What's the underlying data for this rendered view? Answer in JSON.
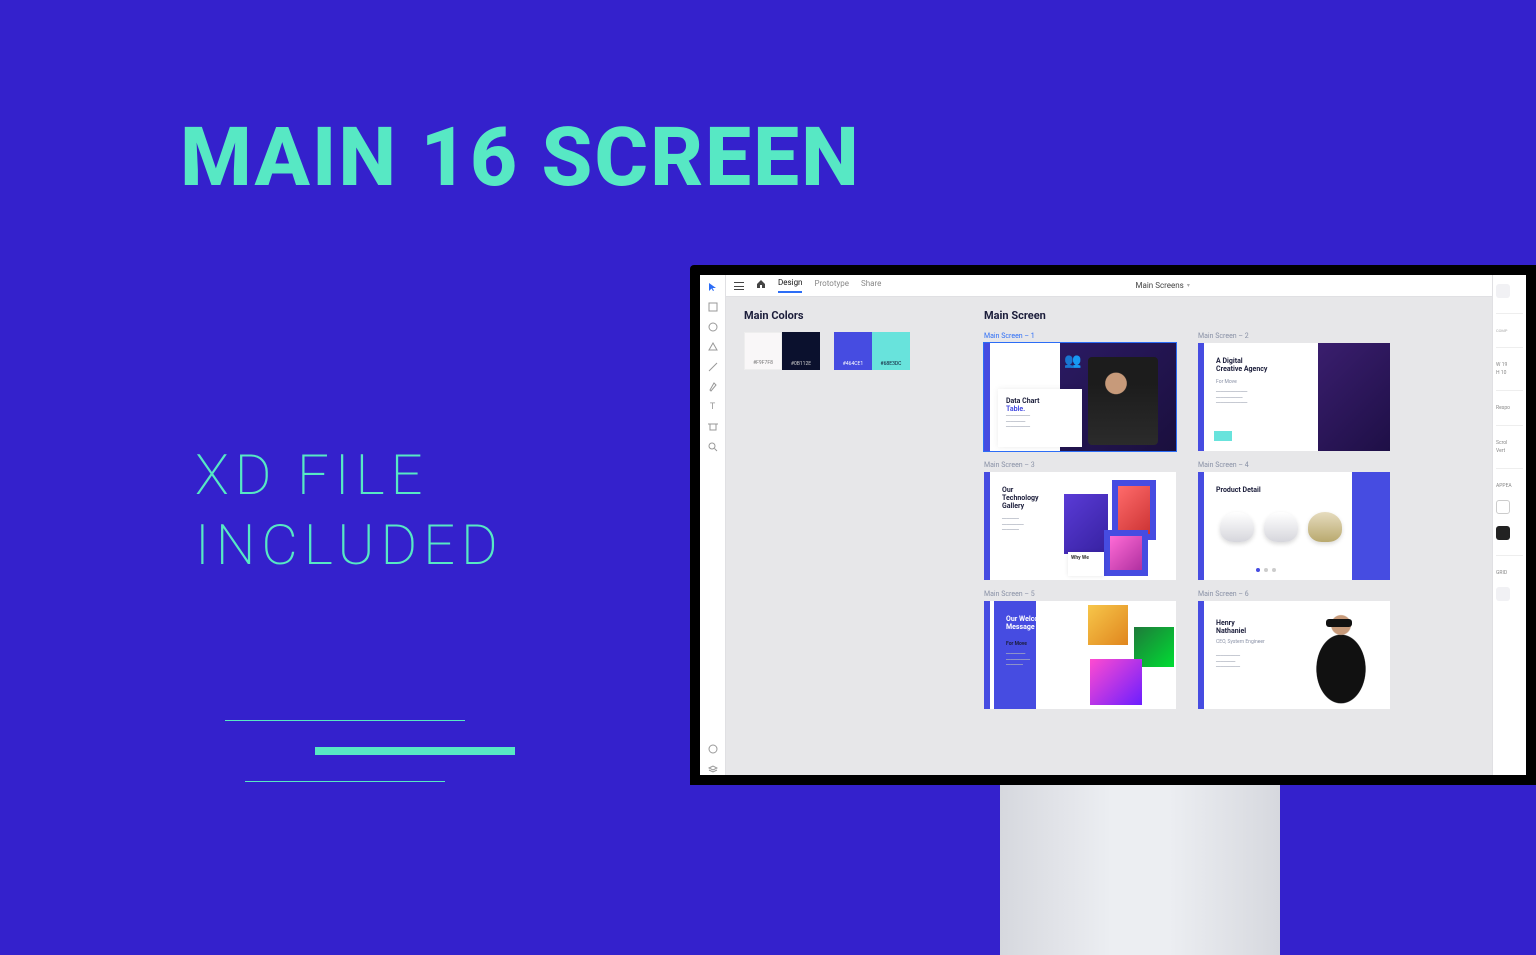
{
  "promo": {
    "headline": "MAIN 16 SCREEN",
    "subhead": "XD FILE\nINCLUDED"
  },
  "app": {
    "tabs": {
      "design": "Design",
      "prototype": "Prototype",
      "share": "Share"
    },
    "doc_title": "Main Screens",
    "sections": {
      "colors_title": "Main Colors",
      "screens_title": "Main Screen"
    },
    "swatches": [
      {
        "hex": "#F9F7F8"
      },
      {
        "hex": "#0B112E"
      },
      {
        "hex": "#464CE1"
      },
      {
        "hex": "#68E3DC"
      }
    ],
    "artboards": [
      {
        "label": "Main Screen – 1",
        "title1": "Data Chart",
        "title2": "Table."
      },
      {
        "label": "Main Screen – 2",
        "title": "A Digital\nCreative Agency",
        "sub": "For Move"
      },
      {
        "label": "Main Screen – 3",
        "title": "Our\nTechnology\nGallery",
        "why": "Why We"
      },
      {
        "label": "Main Screen – 4",
        "title": "Product Detail"
      },
      {
        "label": "Main Screen – 5",
        "title": "Our Welcome\nMessage",
        "sub": "For Move"
      },
      {
        "label": "Main Screen – 6",
        "title": "Henry\nNathaniel",
        "sub": "CEO, System Engineer"
      }
    ],
    "right_panel": {
      "w_label": "W",
      "w_value": "19",
      "h_label": "H",
      "h_value": "10",
      "responsive": "Respo",
      "scroll": "Scrol",
      "vert": "Vert",
      "appearance": "APPEA",
      "grid": "GRID"
    }
  }
}
